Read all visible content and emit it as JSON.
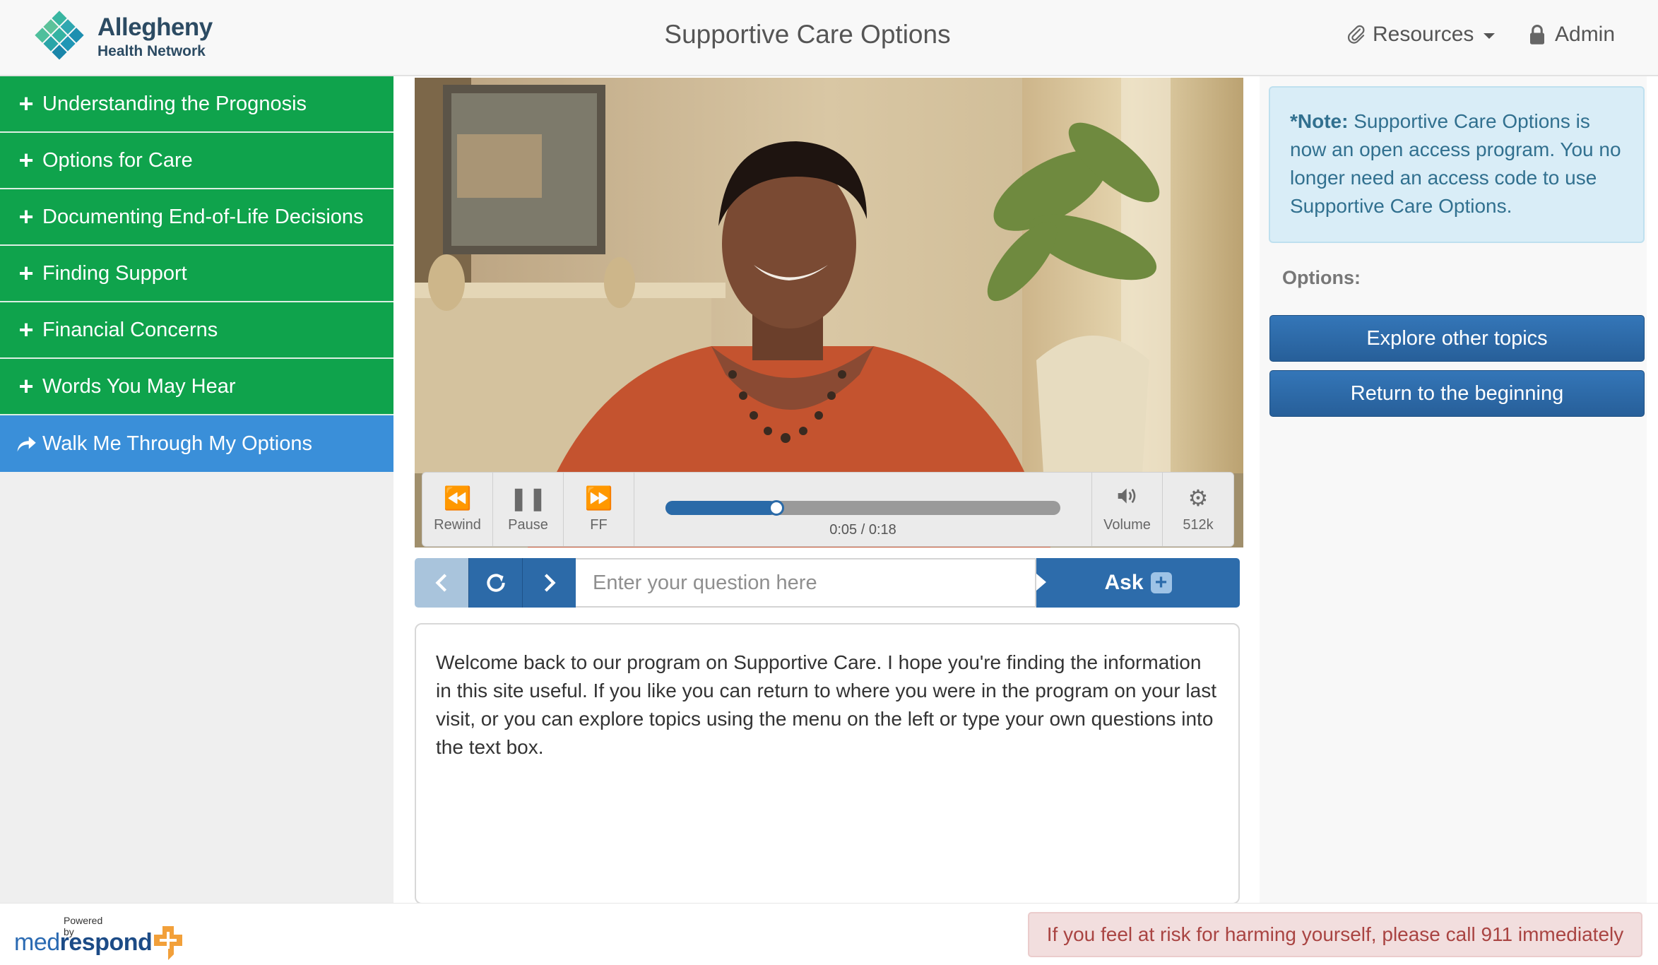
{
  "header": {
    "logo_line1": "Allegheny",
    "logo_line2": "Health Network",
    "title": "Supportive Care Options",
    "resources_label": "Resources",
    "admin_label": "Admin"
  },
  "sidebar": {
    "items": [
      {
        "label": "Understanding the Prognosis",
        "icon": "plus-icon"
      },
      {
        "label": "Options for Care",
        "icon": "plus-icon"
      },
      {
        "label": "Documenting End-of-Life Decisions",
        "icon": "plus-icon"
      },
      {
        "label": "Finding Support",
        "icon": "plus-icon"
      },
      {
        "label": "Financial Concerns",
        "icon": "plus-icon"
      },
      {
        "label": "Words You May Hear",
        "icon": "plus-icon"
      },
      {
        "label": "Walk Me Through My Options",
        "icon": "share-arrow-icon",
        "active": true
      }
    ]
  },
  "video": {
    "controls": {
      "rewind": "Rewind",
      "pause": "Pause",
      "ff": "FF",
      "volume": "Volume",
      "quality": "512k"
    },
    "time": "0:05 / 0:18",
    "progress": 0.28
  },
  "question": {
    "placeholder": "Enter your question here",
    "ask_label": "Ask"
  },
  "transcript": "Welcome back to our program on Supportive Care. I hope you're finding the information in this site useful. If you like you can return to where you were in the program on your last visit, or you can explore topics using the menu on the left or type your own questions into the text box.",
  "note": {
    "prefix": "*Note:",
    "text": " Supportive Care Options is now an open access program. You no longer need an access code to use Supportive Care Options."
  },
  "options": {
    "label": "Options:",
    "explore": "Explore other topics",
    "return": "Return to the beginning"
  },
  "footer": {
    "powered_by": "Powered by",
    "brand_med": "med",
    "brand_respond": "respond",
    "alert": "If you feel at risk for harming yourself, please call 911 immediately"
  },
  "colors": {
    "menu_green": "#0fa34c",
    "menu_active_blue": "#3a8fd9",
    "button_blue": "#2d6cab",
    "note_bg": "#d9edf7",
    "alert_bg": "#f2dede"
  }
}
